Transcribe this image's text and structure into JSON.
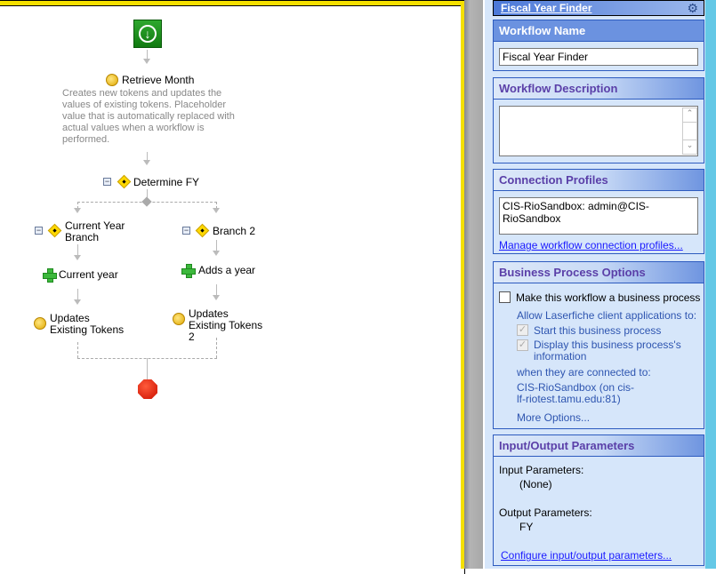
{
  "title_bar": {
    "title": "Fiscal Year Finder"
  },
  "workflow": {
    "start_label": "",
    "retrieve_month": {
      "label": "Retrieve Month",
      "description": "Creates new tokens and updates the values of existing tokens. Placeholder value that is automatically replaced with actual values when a workflow is performed."
    },
    "determine_fy": "Determine FY",
    "branch1": {
      "label": "Current Year Branch",
      "step1": "Current year",
      "step2": "Updates Existing Tokens"
    },
    "branch2": {
      "label": "Branch 2",
      "step1": "Adds a year",
      "step2": "Updates Existing Tokens 2"
    }
  },
  "panel": {
    "name": {
      "header": "Workflow Name",
      "value": "Fiscal Year Finder"
    },
    "description": {
      "header": "Workflow Description",
      "value": ""
    },
    "connections": {
      "header": "Connection Profiles",
      "value": "CIS-RioSandbox: admin@CIS-RioSandbox",
      "link": "Manage workflow connection profiles..."
    },
    "business": {
      "header": "Business Process Options",
      "make": "Make this workflow a business process",
      "allow": "Allow Laserfiche client applications to:",
      "start": "Start this business process",
      "display": "Display this business process's information",
      "when": "when they are connected to:",
      "server": "CIS-RioSandbox (on cis-lf-riotest.tamu.edu:81)",
      "more": "More Options..."
    },
    "io": {
      "header": "Input/Output Parameters",
      "input_label": "Input Parameters:",
      "input_value": "(None)",
      "output_label": "Output Parameters:",
      "output_value": "FY",
      "link": "Configure input/output parameters..."
    }
  }
}
